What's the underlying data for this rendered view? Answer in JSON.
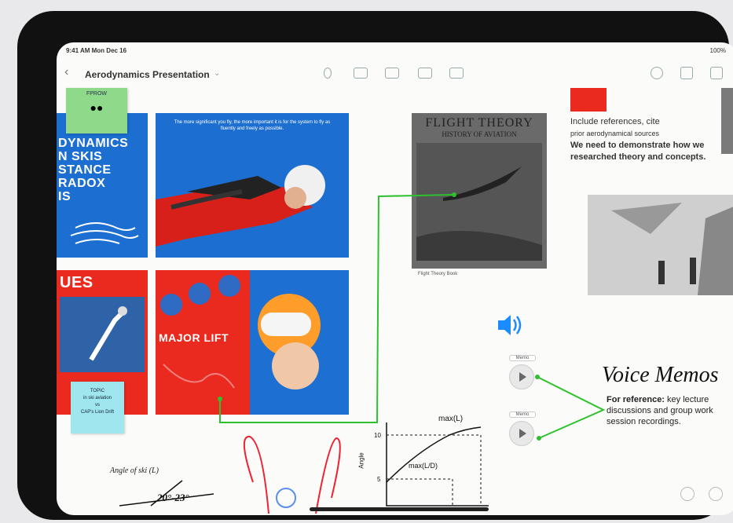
{
  "status": {
    "time": "9:41 AM",
    "date": "Mon Dec 16",
    "battery": "100%"
  },
  "header": {
    "title": "Aerodynamics Presentation"
  },
  "slides": {
    "blue_left_text": "DYNAMICS\nN SKIS\nSTANCE\nRADOX\nIS",
    "blue_top_text": "The more significant you fly, the more important it is for the system to fly as fluently and freely as possible.",
    "red_left_text": "UES",
    "red_center_text": "MAJOR LIFT"
  },
  "stickies": {
    "green_top": "FPROW",
    "cyan": "TOPIC\nin ski aviation\nvs\nCAP's Lion Drift"
  },
  "book": {
    "title": "FLIGHT THEORY",
    "subtitle": "HISTORY OF AVIATION",
    "caption": "Flight Theory Book"
  },
  "notes": {
    "references_line1": "Include references, cite",
    "references_line2": "prior aerodynamical sources",
    "references_bold": "We need to demonstrate how we researched theory and concepts."
  },
  "voice_memos": {
    "title": "Voice Memos",
    "desc_bold": "For reference:",
    "desc_rest": "key lecture discussions and group work session recordings.",
    "memo1_label": "Memo",
    "memo2_label": "Memo"
  },
  "sketch": {
    "angle_label": "Angle of ski (L)",
    "angle_value": "20°-23°",
    "max_label": "max(L)",
    "max_label2": "max(L/D)",
    "tick_10": "10",
    "tick_5": "5",
    "axis_label": "Angle"
  },
  "colors": {
    "accent_blue": "#1c6fd0",
    "accent_red": "#ea2a1f",
    "connector_green": "#2ec12e",
    "sticky_green": "#8fd98a",
    "sticky_cyan": "#9fe6ee"
  }
}
